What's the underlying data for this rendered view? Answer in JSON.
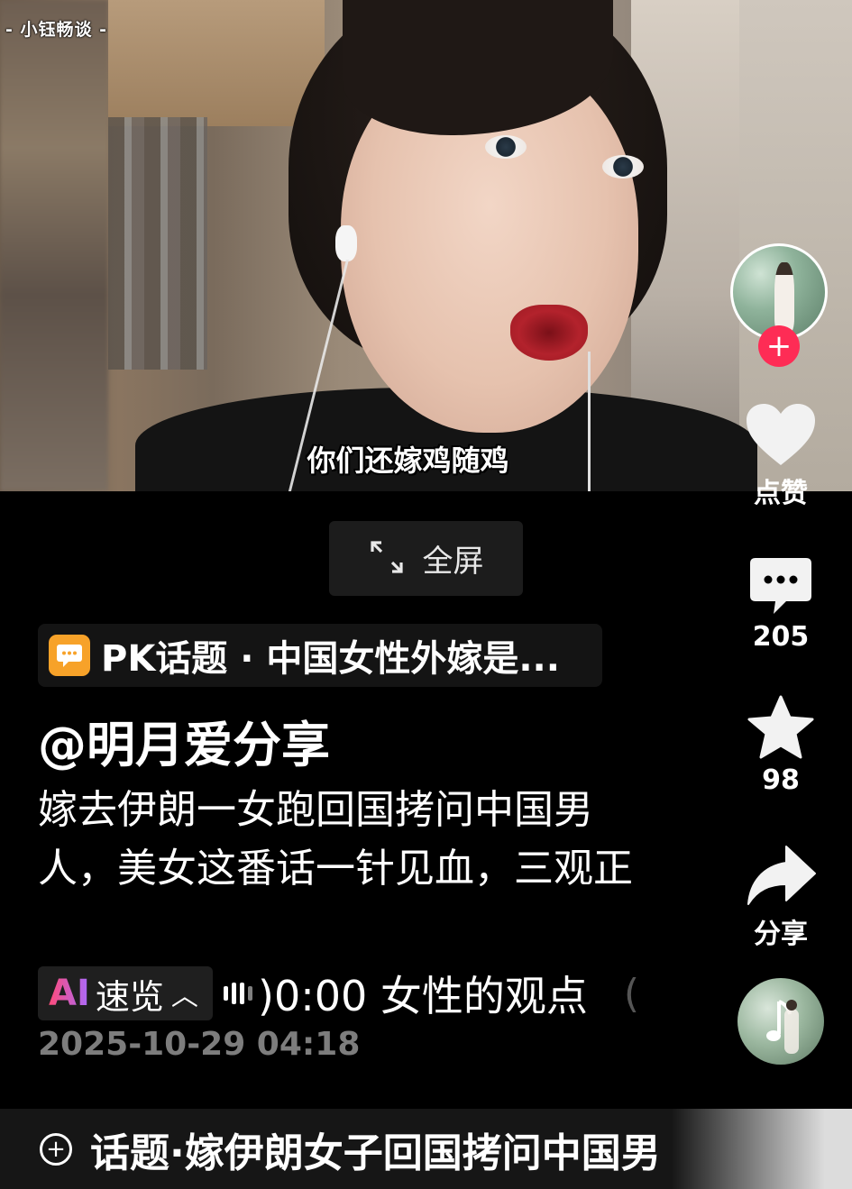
{
  "video": {
    "watermark": "- 小钰畅谈 -",
    "subtitle": "你们还嫁鸡随鸡"
  },
  "fullscreen": {
    "label": "全屏",
    "icon": "expand-icon"
  },
  "rail": {
    "follow_icon": "plus-icon",
    "like_label": "点赞",
    "comment_count": "205",
    "favorite_count": "98",
    "share_label": "分享"
  },
  "info": {
    "pk_topic": "PK话题 · 中国女性外嫁是...",
    "author": "@明月爱分享",
    "description": "嫁去伊朗一女跑回国拷问中国男人，美女这番话一针见血，三观正",
    "ai_mark": "AI",
    "ai_label": "速览",
    "ai_time_text": ")0:00 女性的观点",
    "ai_more": "(",
    "date": "2025-10-29 04:18"
  },
  "topic_bar": {
    "text": "话题·嫁伊朗女子回国拷问中国男"
  },
  "colors": {
    "accent": "#fe2c55",
    "pk_orange": "#f7a229"
  }
}
